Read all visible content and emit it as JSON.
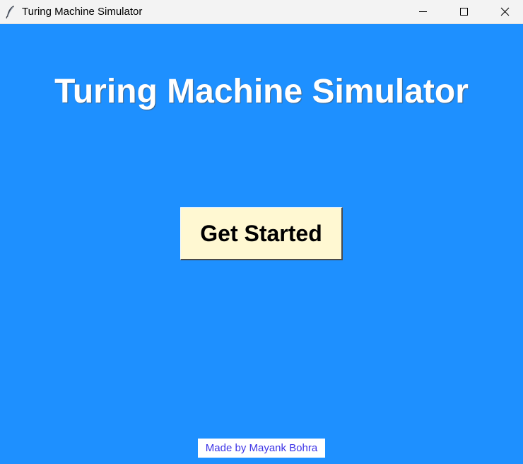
{
  "window": {
    "title": "Turing Machine Simulator",
    "app_icon": "feather-icon",
    "controls": {
      "minimize_icon": "minimize-icon",
      "maximize_icon": "maximize-icon",
      "close_icon": "close-icon"
    }
  },
  "main": {
    "heading": "Turing Machine Simulator",
    "get_started_label": "Get Started",
    "credit": "Made by Mayank Bohra"
  },
  "colors": {
    "background": "#1e90ff",
    "heading_text": "#ffffff",
    "button_background": "#fff8d2",
    "credit_text": "#3c33e6"
  }
}
